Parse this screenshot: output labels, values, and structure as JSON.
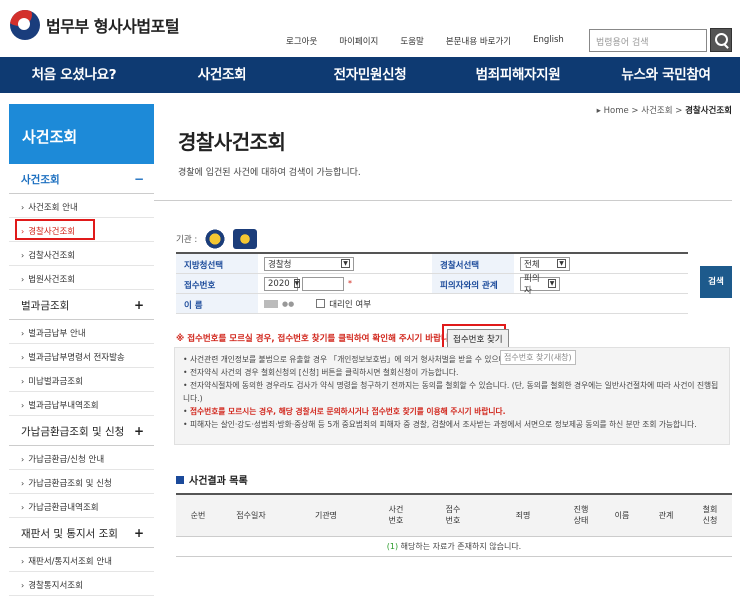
{
  "header": {
    "logo_text": "법무부 형사사법포털",
    "util_links": [
      "로그아웃",
      "마이페이지",
      "도움말",
      "본문내용 바로가기",
      "English"
    ],
    "search_placeholder": "법령용어 검색"
  },
  "gnb": [
    "처음 오셨나요?",
    "사건조회",
    "전자민원신청",
    "범죄피해자지원",
    "뉴스와 국민참여"
  ],
  "sidebar": {
    "title": "사건조회",
    "groups": [
      {
        "label": "사건조회",
        "toggle": "−",
        "items": [
          "사건조회 안내",
          "경찰사건조회",
          "검찰사건조회",
          "법원사건조회"
        ]
      },
      {
        "label": "벌과금조회",
        "toggle": "+",
        "items": [
          "벌과금납부 안내",
          "벌과금납부명령서 전자발송",
          "미납벌과금조회",
          "벌과금납부내역조회"
        ]
      },
      {
        "label": "가납금환급조회 및 신청",
        "toggle": "+",
        "items": [
          "가납금환급/신청 안내",
          "가납금환급조회 및 신청",
          "가납금환급내역조회"
        ]
      },
      {
        "label": "재판서 및 통지서 조회",
        "toggle": "+",
        "items": [
          "재판서/통지서조회 안내",
          "경찰통지서조회"
        ]
      }
    ]
  },
  "main": {
    "breadcrumb": [
      "Home",
      "사건조회",
      "경찰사건조회"
    ],
    "title": "경찰사건조회",
    "description": "경찰에 입건된 사건에 대하여 검색이 가능합니다.",
    "agency_label": "기관 :",
    "form": {
      "region_label": "지방청선택",
      "region_value": "경찰청",
      "station_label": "경찰서선택",
      "station_value": "전체",
      "receipt_label": "접수번호",
      "receipt_year": "2020",
      "relation_label": "피의자와의 관계",
      "relation_value": "피의자",
      "name_label": "이 름",
      "proxy_label": "대리인 여부",
      "search_button": "검색"
    },
    "notice": "※ 접수번호를 모르실 경우, 접수번호 찾기를 클릭하여 확인해 주시기 바랍니다.",
    "find_button": "접수번호 찾기",
    "tooltip": "접수번호 찾기(새창)",
    "info_lines": [
      "사건관련 개인정보를 불법으로 유출할 경우 「개인정보보호법」에 의거 형사처벌을 받을 수 있으니 주의하시기 바랍니다.",
      "전자약식 사건의 경우 철회신청의 [신청] 버튼을 클릭하시면 철회신청이 가능합니다.",
      "전자약식절차에 동의한 경우라도 검사가 약식 명령을 청구하기 전까지는 동의를 철회할 수 있습니다. (단, 동의를 철회한 경우에는 일반사건절차에 따라 사건이 진행됩니다.)",
      "접수번호를 모르시는 경우, 해당 경찰서로 문의하시거나 접수번호 찾기를 이용해 주시기 바랍니다.",
      "피해자는 살인·강도·성범죄·방화·중상해 등 5개 중요범죄의 피해자 중 경찰, 검찰에서 조사받는 과정에서 서면으로 정보제공 동의를 하신 분만 조회 가능합니다."
    ],
    "result_title": "사건결과 목록",
    "columns": [
      "순번",
      "접수일자",
      "기관명",
      "사건\n번호",
      "접수\n번호",
      "죄명",
      "진행\n상태",
      "이름",
      "관계",
      "철회\n신청"
    ],
    "empty_count": "(1)",
    "empty_text": "해당하는 자료가 존재하지 않습니다."
  }
}
